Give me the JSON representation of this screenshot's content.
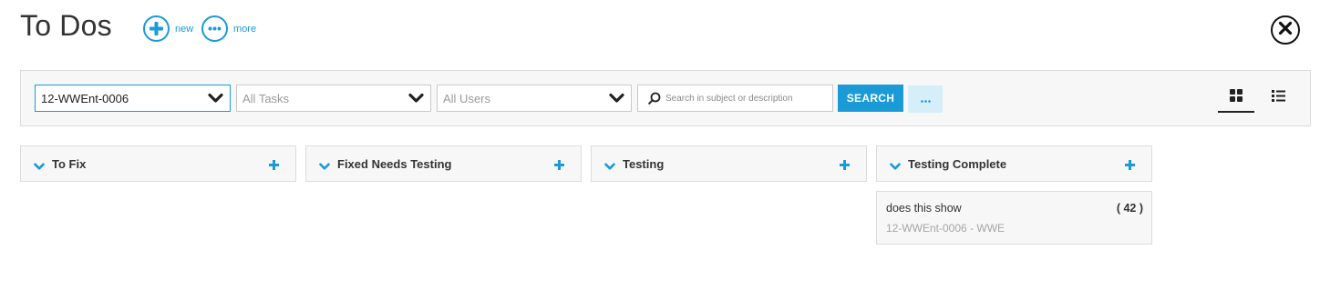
{
  "header": {
    "title": "To Dos",
    "new_label": "new",
    "more_label": "more"
  },
  "filters": {
    "project_value": "12-WWEnt-0006",
    "tasks_value": "All Tasks",
    "users_value": "All Users",
    "search_placeholder": "Search in subject or description",
    "search_button": "SEARCH",
    "more_button": "..."
  },
  "columns": [
    {
      "title": "To Fix"
    },
    {
      "title": "Fixed Needs Testing"
    },
    {
      "title": "Testing"
    },
    {
      "title": "Testing Complete"
    }
  ],
  "cards": [
    {
      "subject": "does this show",
      "count": "( 42 )",
      "meta": "12-WWEnt-0006 - WWE"
    }
  ],
  "colors": {
    "accent": "#1a9bd7",
    "panel_bg": "#f7f7f7",
    "border": "#dcdcdc",
    "muted_text": "#a5a5a5"
  },
  "icons": {
    "new": "plus-circle-icon",
    "more": "ellipsis-circle-icon",
    "close": "close-circle-icon",
    "grid_view": "grid-view-icon",
    "list_view": "list-view-icon",
    "search": "magnifier-icon"
  }
}
